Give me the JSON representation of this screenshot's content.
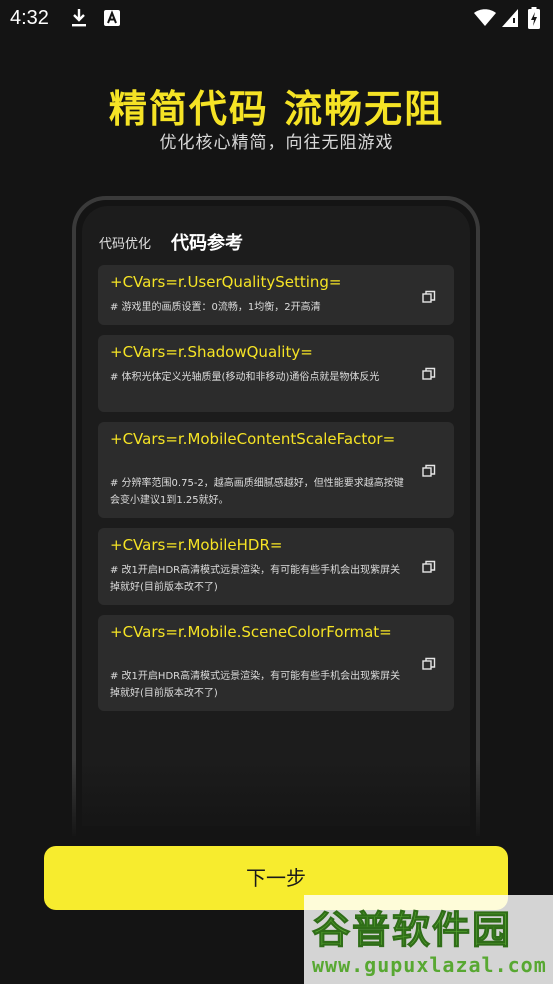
{
  "status_bar": {
    "time": "4:32"
  },
  "header": {
    "title": "精简代码 流畅无阻",
    "subtitle": "优化核心精简，向往无阻游戏"
  },
  "tabs": [
    {
      "label": "代码优化"
    },
    {
      "label": "代码参考"
    }
  ],
  "cards": [
    {
      "code": "+CVars=r.UserQualitySetting=",
      "desc": "# 游戏里的画质设置：0流畅，1均衡，2开高清"
    },
    {
      "code": "+CVars=r.ShadowQuality=",
      "desc": "# 体积光体定义光轴质量(移动和非移动)通俗点就是物体反光"
    },
    {
      "code": "+CVars=r.MobileContentScaleFactor=",
      "desc": "# 分辨率范围0.75-2，越高画质细腻感越好，但性能要求越高按键会变小建议1到1.25就好。"
    },
    {
      "code": "+CVars=r.MobileHDR=",
      "desc": "# 改1开启HDR高清模式远景渲染，有可能有些手机会出现紫屏关掉就好(目前版本改不了)"
    },
    {
      "code": "+CVars=r.Mobile.SceneColorFormat=",
      "desc": "# 改1开启HDR高清模式远景渲染，有可能有些手机会出现紫屏关掉就好(目前版本改不了)"
    }
  ],
  "next_button": {
    "label": "下一步"
  },
  "watermark": {
    "text": "谷普软件园",
    "url": "www.gupuxlazal.com"
  }
}
